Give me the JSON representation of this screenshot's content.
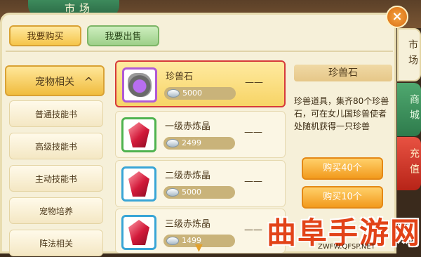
{
  "header": {
    "title": "市场",
    "close_label": "×"
  },
  "top_tabs": {
    "buy": "我要购买",
    "sell": "我要出售"
  },
  "categories": {
    "head": "宠物相关",
    "head_arrow": "^",
    "items": [
      "普通技能书",
      "高级技能书",
      "主动技能书",
      "宠物培养",
      "阵法相关"
    ]
  },
  "items": [
    {
      "name": "珍兽石",
      "price": "5000",
      "dash": "——"
    },
    {
      "name": "一级赤炼晶",
      "price": "2499",
      "dash": "——"
    },
    {
      "name": "二级赤炼晶",
      "price": "5000",
      "dash": "——"
    },
    {
      "name": "三级赤炼晶",
      "price": "1499",
      "dash": "——"
    }
  ],
  "detail": {
    "title": "珍兽石",
    "description": "珍兽道具，集齐80个珍兽石，可在女儿国珍兽使者处随机获得一只珍兽"
  },
  "buttons": {
    "buy40": "购买40个",
    "buy10": "购买10个"
  },
  "side_tabs": [
    "市场",
    "商城",
    "充值"
  ],
  "watermark": {
    "text": "曲阜手游网",
    "url": "ZWFW.QFSP.NET"
  },
  "colors": {
    "accent_orange": "#f29a1c",
    "selected_border": "#d63a3a",
    "green_tab": "#2e7b4c",
    "red_tab": "#b72418"
  }
}
